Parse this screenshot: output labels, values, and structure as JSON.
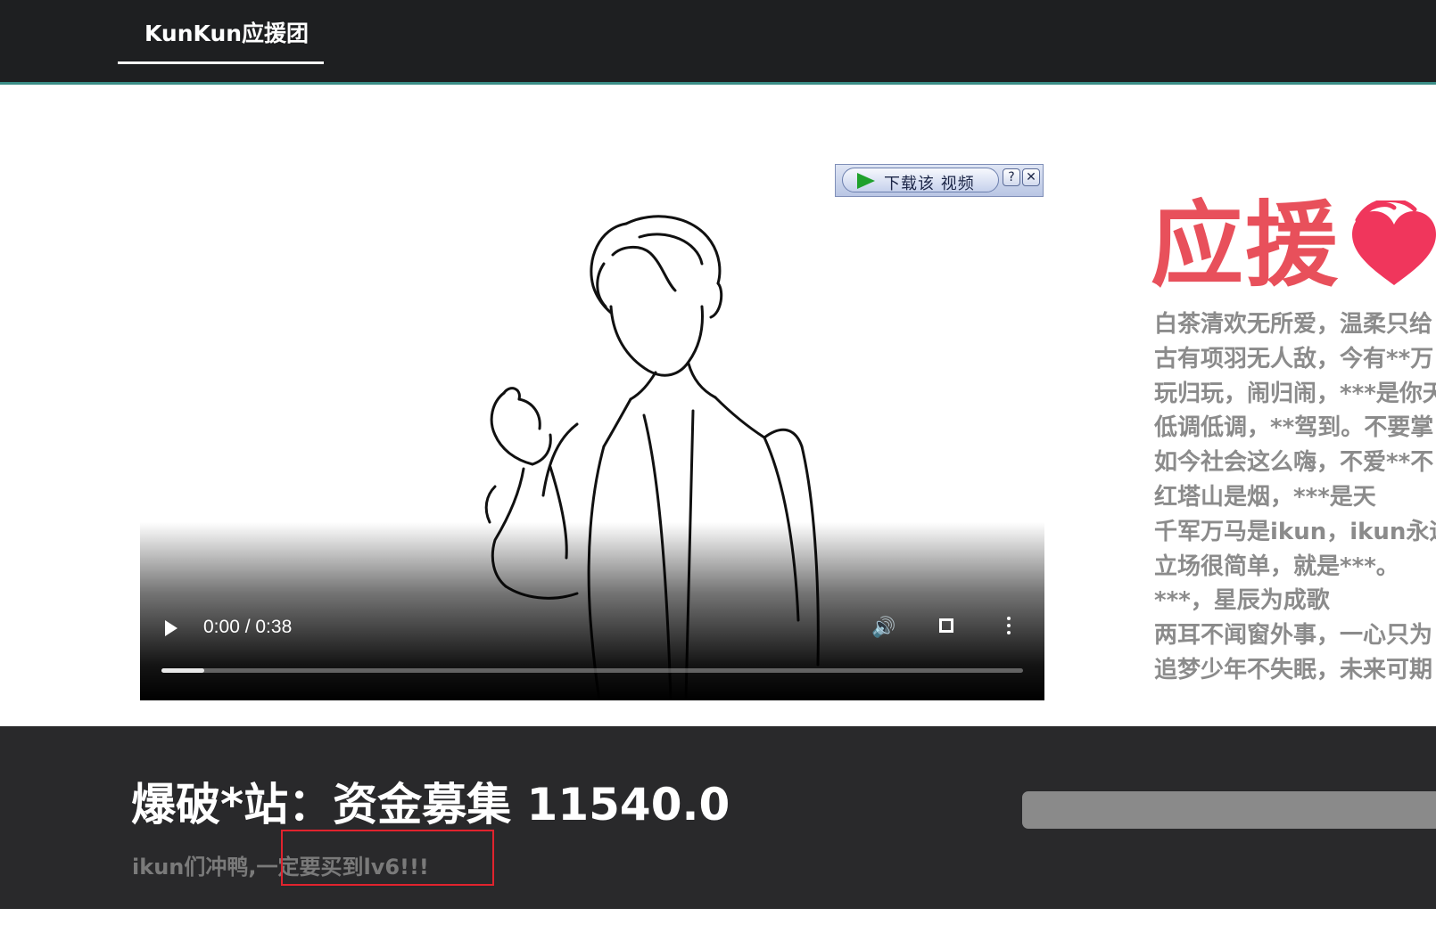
{
  "header": {
    "brand": "KunKun应援团"
  },
  "video": {
    "time_display": "0:00 / 0:38",
    "progress_fraction": 0.05
  },
  "download_toolbar": {
    "label": "下载该 视频",
    "help_label": "?",
    "close_label": "✕"
  },
  "support": {
    "title": "应援",
    "icon": "heart-icon",
    "lyrics": [
      "白茶清欢无所爱，温柔只给",
      "古有项羽无人敌，今有**万",
      "玩归玩，闹归闹，***是你天",
      "低调低调，**驾到。不要掌",
      "如今社会这么嗨，不爱**不",
      "红塔山是烟，***是天",
      "千军万马是ikun，ikun永远",
      "立场很简单，就是***。",
      "***，星辰为成歌",
      "两耳不闻窗外事，一心只为",
      "追梦少年不失眠，未来可期"
    ]
  },
  "funding": {
    "title": "爆破*站：资金募集 11540.0",
    "subtitle": "ikun们冲鸭,一定要买到lv6!!!"
  },
  "colors": {
    "accent_red": "#e8505b",
    "heart_red": "#f0365c",
    "header_bg": "#1e1f21",
    "footer_bg": "#29292b",
    "highlight_border": "#e0232e"
  }
}
